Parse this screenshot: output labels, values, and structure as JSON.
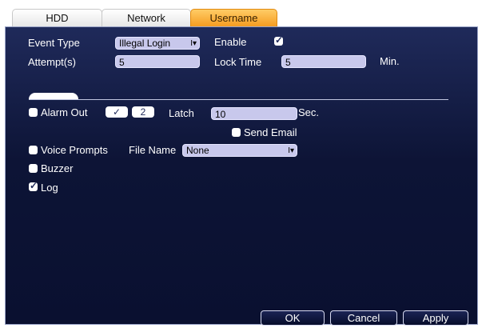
{
  "tabs": [
    "HDD",
    "Network",
    "Username"
  ],
  "form": {
    "event_type_label": "Event Type",
    "event_type_value": "Illegal Login",
    "enable_label": "Enable",
    "enable_checked": true,
    "attempts_label": "Attempt(s)",
    "attempts_value": "5",
    "lock_time_label": "Lock Time",
    "lock_time_value": "5",
    "lock_time_unit": "Min."
  },
  "actions": {
    "alarm_out_label": "Alarm Out",
    "alarm_out_check": "✓",
    "alarm_out_channel": "2",
    "latch_label": "Latch",
    "latch_value": "10",
    "latch_unit": "Sec.",
    "send_email_label": "Send Email",
    "voice_prompts_label": "Voice Prompts",
    "file_name_label": "File Name",
    "file_name_value": "None",
    "buzzer_label": "Buzzer",
    "log_label": "Log",
    "log_checked": true
  },
  "buttons": {
    "ok": "OK",
    "cancel": "Cancel",
    "apply": "Apply"
  }
}
